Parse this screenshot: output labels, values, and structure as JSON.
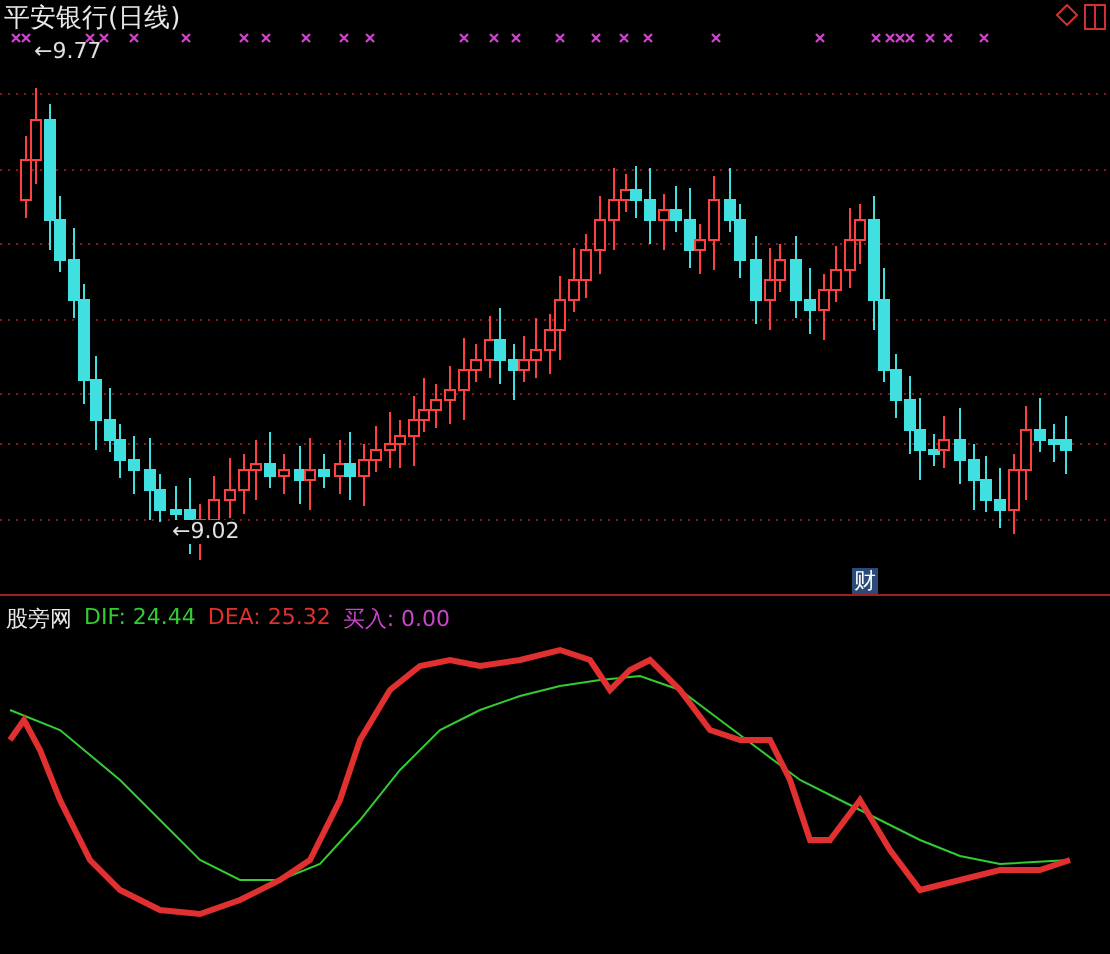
{
  "price_chart": {
    "title": "平安银行(日线)",
    "high_label": "←9.77",
    "low_label": "←9.02",
    "finance_marker": "财"
  },
  "indicator": {
    "name": "股旁网",
    "legend": [
      {
        "label": "DIF: 24.44",
        "color": "#33cc33"
      },
      {
        "label": "DEA: 25.32",
        "color": "#e03030"
      },
      {
        "label": "买入: 0.00",
        "color": "#cc44cc"
      }
    ]
  }
}
